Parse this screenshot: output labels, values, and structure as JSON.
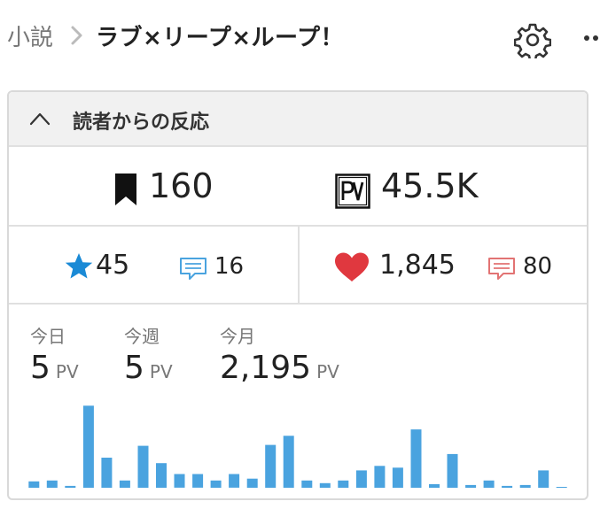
{
  "breadcrumb": {
    "parent": "小説",
    "title": "ラブ×リープ×ループ！"
  },
  "icons": {
    "separator": "chevron-right-icon",
    "settings": "gear-icon",
    "more": "more-icon",
    "collapse": "chevron-up-icon",
    "bookmark": "bookmark-icon",
    "pv": "pv-icon",
    "star": "star-icon",
    "review": "review-icon",
    "heart": "heart-icon",
    "comment": "comment-icon"
  },
  "colors": {
    "star": "#1a8ad6",
    "review": "#4aa3df",
    "heart": "#e0383f",
    "comment": "#e27373",
    "bar": "#4aa3df"
  },
  "reactions": {
    "title": "読者からの反応",
    "bookmarks": "160",
    "page_views": "45.5K",
    "stars": "45",
    "reviews": "16",
    "hearts": "1,845",
    "comments": "80"
  },
  "pv_stats": {
    "today_label": "今日",
    "today_value": "5",
    "week_label": "今週",
    "week_value": "5",
    "month_label": "今月",
    "month_value": "2,195",
    "unit": "PV"
  },
  "chart_data": {
    "type": "bar",
    "title": "",
    "xlabel": "",
    "ylabel": "",
    "values": [
      7,
      8,
      2,
      90,
      33,
      8,
      46,
      27,
      15,
      15,
      8,
      15,
      10,
      47,
      57,
      8,
      5,
      8,
      19,
      24,
      22,
      64,
      4,
      37,
      3,
      8,
      2,
      3,
      19,
      1
    ],
    "ylim": [
      0,
      100
    ]
  }
}
